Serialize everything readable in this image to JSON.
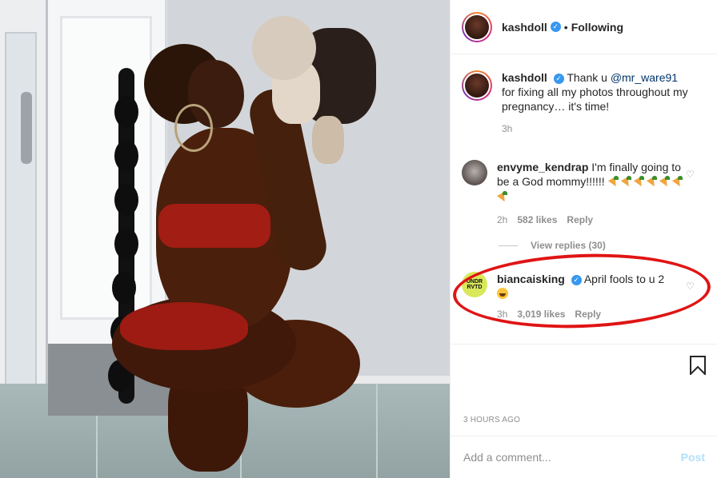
{
  "post": {
    "username": "kashdoll",
    "verified_icon": "check-icon",
    "separator": "•",
    "follow_status": "Following"
  },
  "caption": {
    "username": "kashdoll",
    "text_before_mention": "Thank u ",
    "mention": "@mr_ware91",
    "text_after_mention": " for fixing all my photos throughout my pregnancy… it's time!",
    "time": "3h"
  },
  "comments": [
    {
      "username": "envyme_kendrap",
      "text": "I'm finally going to be a God mommy!!!!!! ",
      "emoji": "carrot-emoji",
      "time": "2h",
      "likes": "582 likes",
      "reply_label": "Reply",
      "view_replies": "View replies (30)"
    },
    {
      "username": "biancaisking",
      "verified_icon": "check-icon",
      "text": "April fools to u 2",
      "emoji": "laughing-emoji",
      "avatar_text": "UNDR RVTD",
      "time": "3h",
      "likes": "3,019 likes",
      "reply_label": "Reply"
    }
  ],
  "timestamp": "3 HOURS AGO",
  "add_comment": {
    "placeholder": "Add a comment...",
    "post_label": "Post"
  },
  "colors": {
    "link": "#003569",
    "verified": "#3897f0",
    "annotation_circle": "#e01414",
    "post_button_disabled": "#b2dffc"
  }
}
